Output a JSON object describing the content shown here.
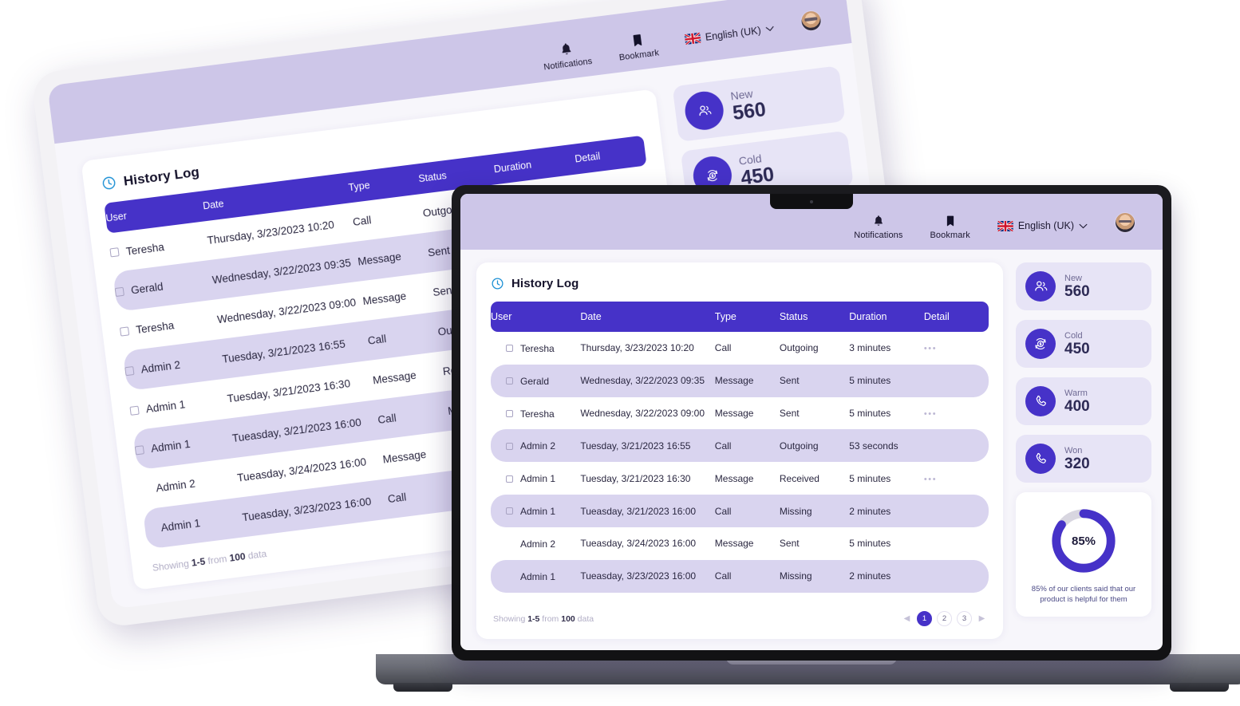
{
  "header": {
    "notifications_label": "Notifications",
    "bookmark_label": "Bookmark",
    "language_label": "English (UK)",
    "bell_icon": "bell-icon",
    "bookmark_icon": "bookmark-icon",
    "flag_icon": "uk-flag-icon",
    "chevron_icon": "chevron-down-icon",
    "avatar_icon": "user-avatar"
  },
  "history": {
    "title": "History Log",
    "clock_icon": "clock-icon",
    "columns": [
      "User",
      "Date",
      "Type",
      "Status",
      "Duration",
      "Detail"
    ],
    "rows": [
      {
        "user": "Teresha",
        "date": "Thursday, 3/23/2023 10:20",
        "type": "Call",
        "status": "Outgoing",
        "duration": "3 minutes",
        "checkbox": true,
        "detail": true,
        "alt": false
      },
      {
        "user": "Gerald",
        "date": "Wednesday, 3/22/2023 09:35",
        "type": "Message",
        "status": "Sent",
        "duration": "5 minutes",
        "checkbox": true,
        "detail": false,
        "alt": true
      },
      {
        "user": "Teresha",
        "date": "Wednesday, 3/22/2023 09:00",
        "type": "Message",
        "status": "Sent",
        "duration": "5 minutes",
        "checkbox": true,
        "detail": true,
        "alt": false
      },
      {
        "user": "Admin 2",
        "date": "Tuesday, 3/21/2023 16:55",
        "type": "Call",
        "status": "Outgoing",
        "duration": "53 seconds",
        "checkbox": true,
        "detail": false,
        "alt": true
      },
      {
        "user": "Admin 1",
        "date": "Tuesday, 3/21/2023 16:30",
        "type": "Message",
        "status": "Received",
        "duration": "5 minutes",
        "checkbox": true,
        "detail": true,
        "alt": false
      },
      {
        "user": "Admin 1",
        "date": "Tueasday, 3/21/2023 16:00",
        "type": "Call",
        "status": "Missing",
        "duration": "2 minutes",
        "checkbox": true,
        "detail": false,
        "alt": true
      },
      {
        "user": "Admin 2",
        "date": "Tueasday, 3/24/2023 16:00",
        "type": "Message",
        "status": "Sent",
        "duration": "5 minutes",
        "checkbox": false,
        "detail": false,
        "alt": false
      },
      {
        "user": "Admin 1",
        "date": "Tueasday, 3/23/2023 16:00",
        "type": "Call",
        "status": "Missing",
        "duration": "2 minutes",
        "checkbox": false,
        "detail": false,
        "alt": true
      }
    ],
    "footer": {
      "showing_prefix": "Showing ",
      "showing_range": "1-5",
      "showing_mid": " from ",
      "showing_total": "100",
      "showing_suffix": " data",
      "pages": [
        "1",
        "2",
        "3"
      ],
      "active_page": "1",
      "prev_icon": "chevron-left-icon",
      "next_icon": "chevron-right-icon"
    },
    "detail_dots": "•••"
  },
  "stats": [
    {
      "label": "New",
      "value": "560",
      "icon": "users-icon"
    },
    {
      "label": "Cold",
      "value": "450",
      "icon": "refresh-dollar-icon"
    },
    {
      "label": "Warm",
      "value": "400",
      "icon": "phone-icon"
    },
    {
      "label": "Won",
      "value": "320",
      "icon": "phone-icon"
    }
  ],
  "donut": {
    "percent_label": "85%",
    "caption": "85% of our clients said that our product is helpful for them"
  },
  "colors": {
    "primary": "#4632c8",
    "header_bar": "#cdc6e8",
    "row_alt": "#d9d4ef",
    "card_bg": "#e7e4f6",
    "page_bg": "#f7f6fb",
    "donut_track": "#d8d6e0",
    "clock_icon": "#1a8fd4"
  },
  "chart_data": {
    "type": "pie",
    "title": "",
    "categories": [
      "Helpful",
      "Remaining"
    ],
    "values": [
      85,
      15
    ],
    "labels": [
      "85%",
      ""
    ],
    "colors": [
      "#4632c8",
      "#d8d6e0"
    ],
    "annotations": [
      "85% of our clients said that our product is helpful for them"
    ],
    "legend": "none"
  }
}
